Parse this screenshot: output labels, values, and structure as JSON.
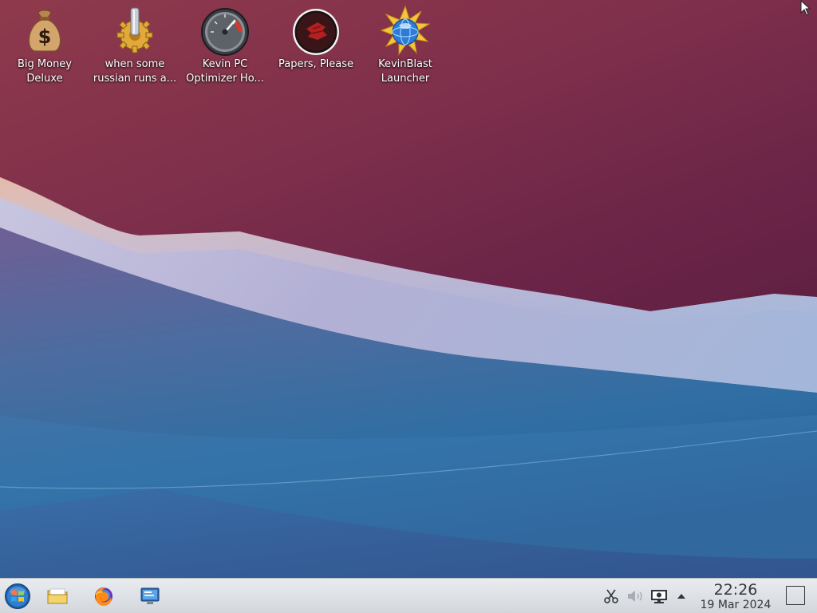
{
  "desktop": {
    "icons": [
      {
        "label_line1": "Big Money",
        "label_line2": "Deluxe",
        "icon": "money-bag-icon"
      },
      {
        "label_line1": "when some",
        "label_line2": "russian runs a...",
        "icon": "gear-icon"
      },
      {
        "label_line1": "Kevin PC",
        "label_line2": "Optimizer Ho...",
        "icon": "speedometer-icon"
      },
      {
        "label_line1": "Papers, Please",
        "label_line2": "",
        "icon": "papers-please-icon"
      },
      {
        "label_line1": "KevinBlast",
        "label_line2": "Launcher",
        "icon": "globe-burst-icon"
      }
    ]
  },
  "taskbar": {
    "launchers": [
      "start-menu-icon",
      "file-manager-icon",
      "firefox-icon",
      "system-settings-icon"
    ],
    "tray": [
      "scissors-icon",
      "volume-icon",
      "network-monitor-icon",
      "tray-expand-icon"
    ],
    "clock": {
      "time": "22:26",
      "date": "19 Mar 2024"
    }
  },
  "colors": {
    "wallpaper_top": "#8f3a4c",
    "wallpaper_bottom": "#2f6ea3",
    "taskbar": "#dfe2e6",
    "text_dark": "#31363b"
  }
}
